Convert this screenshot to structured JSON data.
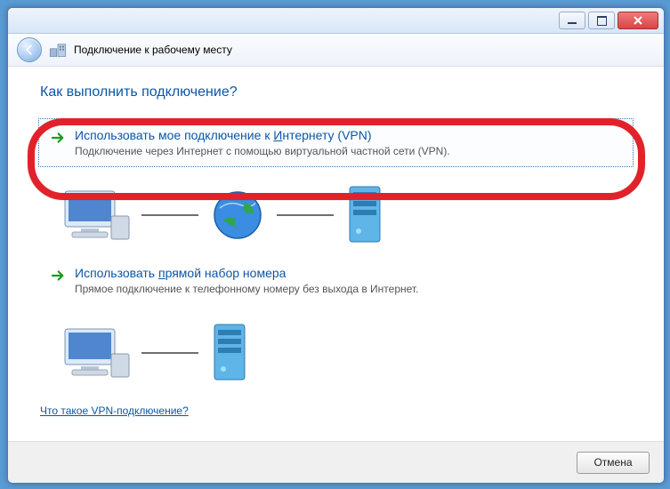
{
  "header": {
    "title": "Подключение к рабочему месту"
  },
  "heading": "Как выполнить подключение?",
  "options": [
    {
      "title_pre": "Использовать мое подключение к ",
      "title_ul": "И",
      "title_post": "нтернету (VPN)",
      "desc": "Подключение через Интернет с помощью виртуальной частной сети (VPN)."
    },
    {
      "title_pre": "Использовать ",
      "title_ul": "п",
      "title_post": "рямой набор номера",
      "desc": "Прямое подключение к телефонному номеру без выхода в Интернет."
    }
  ],
  "link": "Что такое VPN-подключение?",
  "footer": {
    "cancel": "Отмена"
  }
}
